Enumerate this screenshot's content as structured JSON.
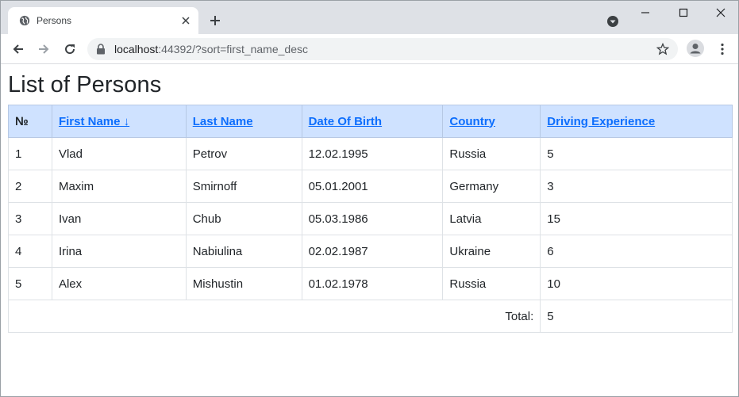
{
  "browser": {
    "tab": {
      "title": "Persons",
      "favicon": "globe-icon"
    },
    "address": {
      "host": "localhost",
      "path": ":44392/?sort=first_name_desc"
    }
  },
  "page": {
    "title": "List of Persons"
  },
  "table": {
    "headers": [
      "№",
      "First Name ↓",
      "Last Name",
      "Date Of Birth",
      "Country",
      "Driving Experience"
    ],
    "rows": [
      [
        "1",
        "Vlad",
        "Petrov",
        "12.02.1995",
        "Russia",
        "5"
      ],
      [
        "2",
        "Maxim",
        "Smirnoff",
        "05.01.2001",
        "Germany",
        "3"
      ],
      [
        "3",
        "Ivan",
        "Chub",
        "05.03.1986",
        "Latvia",
        "15"
      ],
      [
        "4",
        "Irina",
        "Nabiulina",
        "02.02.1987",
        "Ukraine",
        "6"
      ],
      [
        "5",
        "Alex",
        "Mishustin",
        "01.02.1978",
        "Russia",
        "10"
      ]
    ],
    "total": {
      "label": "Total:",
      "value": "5"
    }
  },
  "colors": {
    "header_bg": "#cfe2ff",
    "link": "#0d6efd",
    "tabstrip": "#dee1e6"
  }
}
